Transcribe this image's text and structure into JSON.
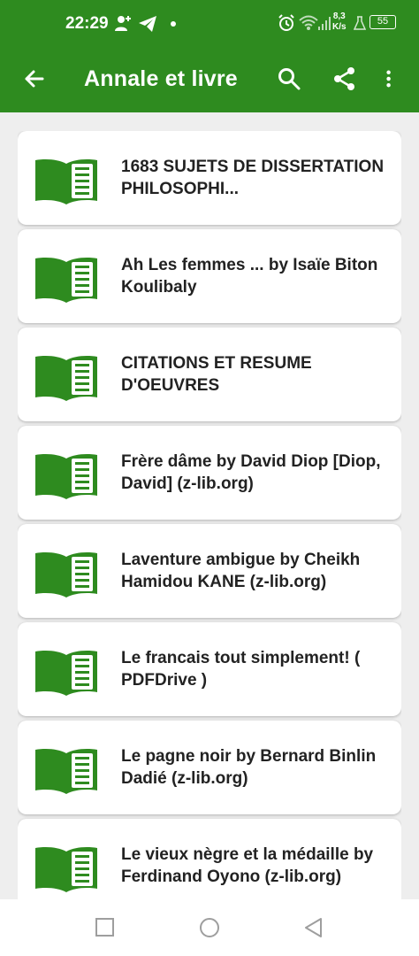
{
  "status_bar": {
    "time": "22:29",
    "net_speed_top": "8,3",
    "net_speed_bottom": "K/s",
    "battery": "55",
    "icons": [
      "person-add-icon",
      "telegram-icon",
      "dot-icon",
      "alarm-icon",
      "wifi-icon",
      "signal-icon",
      "flask-icon",
      "battery-icon"
    ]
  },
  "toolbar": {
    "title": "Annale et livre",
    "back_icon": "arrow-back-icon",
    "search_icon": "search-icon",
    "share_icon": "share-icon",
    "more_icon": "more-vert-icon"
  },
  "colors": {
    "primary": "#2e8b1f",
    "book_icon": "#2e8b1f",
    "background": "#eeeeee",
    "card": "#ffffff",
    "text": "#222222"
  },
  "books": [
    {
      "title": "1683 SUJETS DE DISSERTATION  PHILOSOPHI..."
    },
    {
      "title": "Ah Les femmes ... by Isaïe Biton Koulibaly"
    },
    {
      "title": "CITATIONS ET RESUME D'OEUVRES"
    },
    {
      "title": "Frère dâme by David Diop [Diop, David] (z-lib.org)"
    },
    {
      "title": "Laventure ambigue by Cheikh Hamidou KANE (z-lib.org)"
    },
    {
      "title": "Le francais tout simplement! ( PDFDrive )"
    },
    {
      "title": "Le pagne noir by Bernard Binlin Dadié (z-lib.org)"
    },
    {
      "title": "Le vieux nègre et la médaille by Ferdinand Oyono (z-lib.org)"
    }
  ],
  "nav_bar": {
    "recents_icon": "square-recents-icon",
    "home_icon": "circle-home-icon",
    "back_icon": "triangle-back-icon"
  }
}
